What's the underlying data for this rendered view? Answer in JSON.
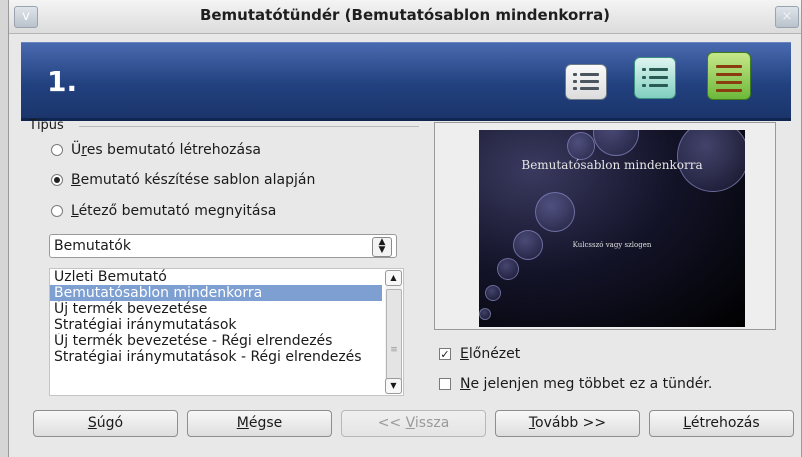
{
  "window": {
    "title": "Bemutatótündér (Bemutatósablon mindenkorra)",
    "menu_icon": "v",
    "close_icon": "×"
  },
  "banner": {
    "step": "1.",
    "icons": [
      "list-icon",
      "list-teal-icon",
      "list-green-icon"
    ]
  },
  "type_group": {
    "label": "Típus",
    "options": [
      {
        "pre": "Ü",
        "key": "r",
        "post": "es bemutató létrehozása",
        "selected": false
      },
      {
        "pre": "",
        "key": "B",
        "post": "emutató készítése sablon alapján",
        "selected": true
      },
      {
        "pre": "",
        "key": "L",
        "post": "étező bemutató megnyitása",
        "selected": false
      }
    ]
  },
  "category_select": {
    "value": "Bemutatók"
  },
  "template_list": {
    "items": [
      "Üzleti Bemutató",
      "Bemutatósablon mindenkorra",
      "Új termék bevezetése",
      "Stratégiai iránymutatások",
      "Új termék bevezetése - Régi elrendezés",
      "Stratégiai iránymutatások - Régi elrendezés"
    ],
    "selected_index": 1
  },
  "preview": {
    "slide_title": "Bemutatósablon mindenkorra",
    "slide_subtitle": "Kulcsszó vagy szlogen",
    "preview_check": {
      "key": "E",
      "post": "lőnézet",
      "checked": true
    },
    "no_show_check": {
      "key": "N",
      "post": "e jelenjen meg többet ez a tündér.",
      "checked": false
    }
  },
  "buttons": {
    "help": {
      "key": "S",
      "post": "úgó"
    },
    "cancel": {
      "key": "M",
      "post": "égse"
    },
    "back": {
      "pre": "<< ",
      "key": "V",
      "post": "issza",
      "disabled": true
    },
    "next": {
      "key": "T",
      "post": "ovább >>"
    },
    "create": {
      "key": "L",
      "post": "étrehozás"
    }
  },
  "colors": {
    "banner": "#22417f",
    "selection": "#7d9fd1",
    "slide_bg": "#14142a"
  }
}
